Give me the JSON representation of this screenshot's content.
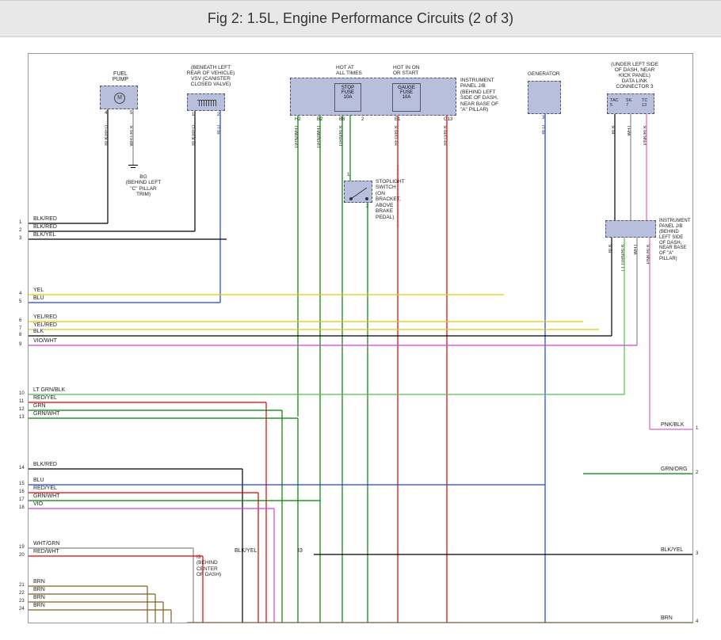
{
  "title": "Fig 2: 1.5L, Engine Performance Circuits (2 of 3)",
  "components": {
    "fuel_pump": {
      "label": "FUEL\nPUMP",
      "pins": [
        "4",
        "5"
      ]
    },
    "vsv": {
      "label": "(BENEATH LEFT\nREAR OF VEHICLE)\nVSV (CANISTER\nCLOSED VALVE)",
      "pins": [
        "1",
        "2"
      ]
    },
    "fuse_box": {
      "hot_all": "HOT AT\nALL TIMES",
      "hot_on": "HOT IN ON\nOR START",
      "stop_fuse": "STOP\nFUSE\n10A",
      "gauge_fuse": "GAUGE\nFUSE\n10A",
      "pins": [
        "H2",
        "B2",
        "B8",
        "2",
        "E1",
        "G13"
      ],
      "note": "INSTRUMENT\nPANEL J/B\n(BEHIND LEFT\nSIDE OF DASH,\nNEAR BASE OF\n\"A\" PILLAR)"
    },
    "generator": {
      "label": "GENERATOR",
      "pins": [
        "3"
      ]
    },
    "dlc": {
      "label": "(UNDER LEFT SIDE\nOF DASH, NEAR\nKICK PANEL)\nDATA LINK\nCONNECTOR 3",
      "pins": [
        "TAC\n5",
        "SIL\n7",
        "TC\n13"
      ]
    },
    "stoplight": {
      "label": "STOPLIGHT\nSWITCH\n(ON\nBRACKET,\nABOVE\nBRAKE\nPEDAL)",
      "pins": [
        "1",
        "2"
      ]
    },
    "ground_bg": "BG\n(BEHIND LEFT\n\"C\" PILLAR\nTRIM)",
    "jb_conn": {
      "label": "INSTRUMENT\nPANEL J/B\n(BEHIND\nLEFT SIDE\nOF DASH,\nNEAR BASE\nOF \"A\"\nPILLAR)",
      "pins": [
        "H13",
        "H12",
        "H11",
        "H1"
      ]
    },
    "i3_note": "I3\n(BEHIND\nCENTER\nOF DASH)"
  },
  "vertical_wire_labels": {
    "fuelpump_4": "BLK/RED",
    "fuelpump_5": "WHT/BLK",
    "vsv_1": "BLK/RED",
    "vsv_2": "BLU",
    "fb_h2": "GRN/WHT",
    "fb_b2": "GRN/WHT",
    "fb_b8": "GRN/BLK",
    "fb_2": "",
    "fb_e1": "RED/BLK",
    "fb_g13": "RED/BLK",
    "gen_3": "BLU",
    "dlc_5": "BLK",
    "dlc_7": "WHT",
    "dlc_13": "PNK/BLK",
    "jb_h13": "BLK",
    "jb_h12": "LT GRN/BLK",
    "jb_h11": "WHT",
    "jb_h1": "PNK/BLK"
  },
  "left_wires": [
    {
      "n": "1",
      "label": "BLK/RED",
      "color": "#000"
    },
    {
      "n": "2",
      "label": "BLK/RED",
      "color": "#000"
    },
    {
      "n": "3",
      "label": "BLK/YEL",
      "color": "#000"
    },
    {
      "n": "4",
      "label": "YEL",
      "color": "#e8c800"
    },
    {
      "n": "5",
      "label": "BLU",
      "color": "#2040d8"
    },
    {
      "n": "6",
      "label": "YEL/RED",
      "color": "#e8c800"
    },
    {
      "n": "7",
      "label": "YEL/RED",
      "color": "#e8c800"
    },
    {
      "n": "8",
      "label": "BLK",
      "color": "#000"
    },
    {
      "n": "9",
      "label": "VIO/WHT",
      "color": "#d040e0"
    },
    {
      "n": "10",
      "label": "LT GRN/BLK",
      "color": "#50c050"
    },
    {
      "n": "11",
      "label": "RED/YEL",
      "color": "#e00000"
    },
    {
      "n": "12",
      "label": "GRN",
      "color": "#008000"
    },
    {
      "n": "13",
      "label": "GRN/WHT",
      "color": "#008000"
    },
    {
      "n": "14",
      "label": "BLK/RED",
      "color": "#000"
    },
    {
      "n": "15",
      "label": "BLU",
      "color": "#2040d8"
    },
    {
      "n": "16",
      "label": "RED/YEL",
      "color": "#e00000"
    },
    {
      "n": "17",
      "label": "GRN/WHT",
      "color": "#008000"
    },
    {
      "n": "18",
      "label": "VIO",
      "color": "#d040e0"
    },
    {
      "n": "19",
      "label": "WHT/GRN",
      "color": "#888"
    },
    {
      "n": "20",
      "label": "RED/WHT",
      "color": "#e00000"
    },
    {
      "n": "21",
      "label": "BRN",
      "color": "#806020"
    },
    {
      "n": "22",
      "label": "BRN",
      "color": "#806020"
    },
    {
      "n": "23",
      "label": "BRN",
      "color": "#806020"
    },
    {
      "n": "24",
      "label": "BRN",
      "color": "#806020"
    }
  ],
  "right_wires": [
    {
      "n": "1",
      "label": "PNK/BLK"
    },
    {
      "n": "2",
      "label": "GRN/ORG"
    },
    {
      "n": "3",
      "label": "BLK/YEL"
    },
    {
      "n": "4",
      "label": "BRN"
    }
  ],
  "mid_labels": {
    "blkyel_1": "BLK/YEL",
    "blkyel_2": "I3",
    "blkyel_3": "BLK/YEL"
  }
}
